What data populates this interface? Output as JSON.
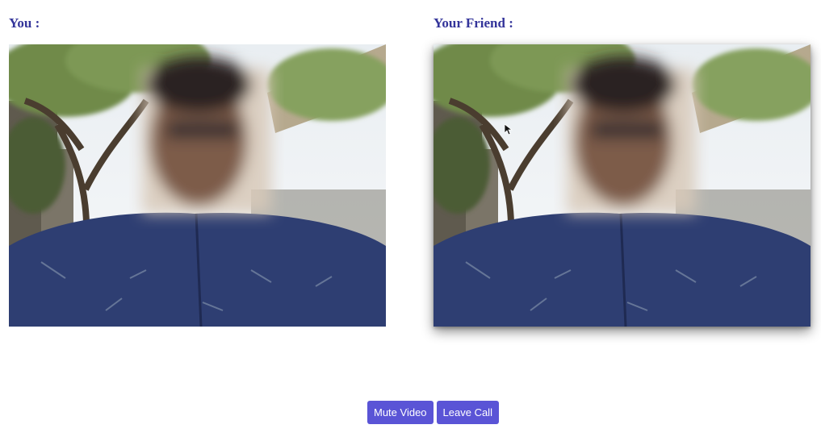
{
  "labels": {
    "you": "You :",
    "friend": "Your Friend :"
  },
  "controls": {
    "mute_video": "Mute Video",
    "leave_call": "Leave Call"
  },
  "colors": {
    "label": "#33349a",
    "button_bg": "#5a54d6",
    "button_text": "#ffffff"
  }
}
